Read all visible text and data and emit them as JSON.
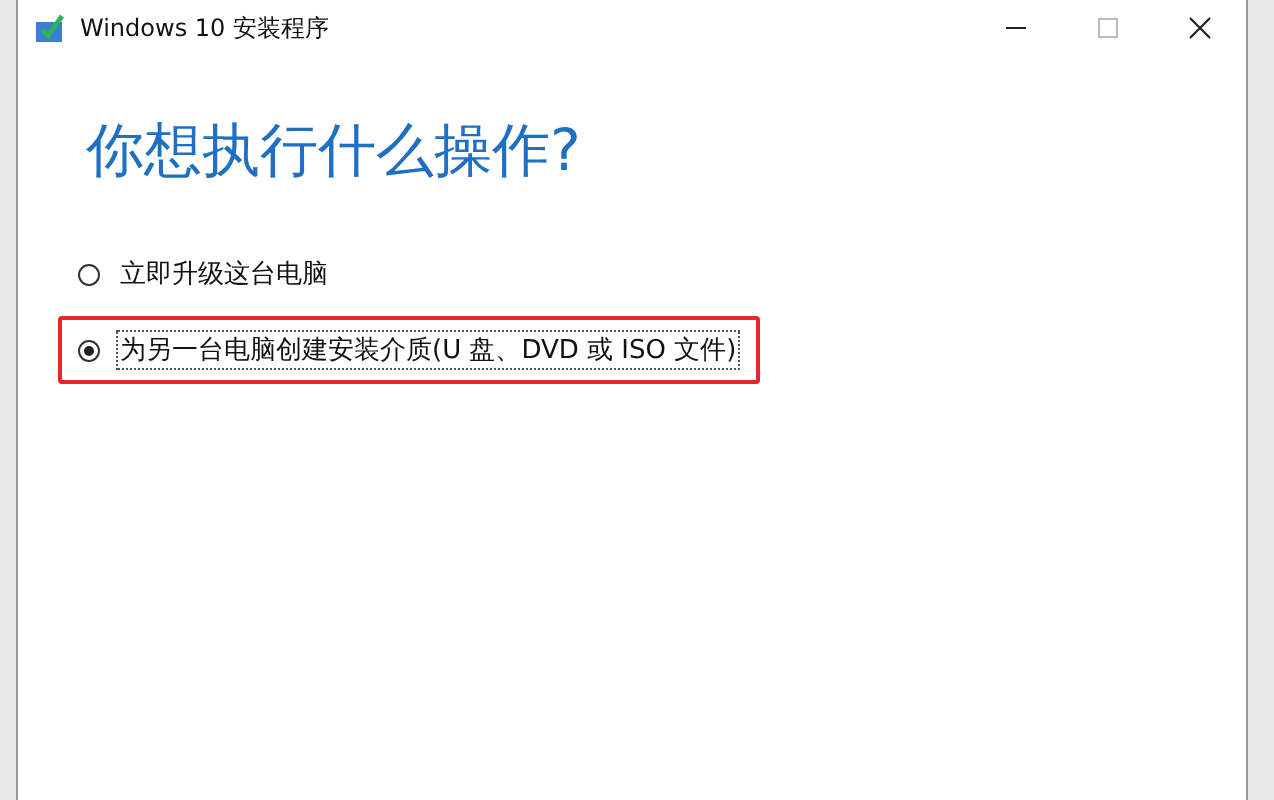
{
  "window": {
    "title": "Windows 10 安装程序"
  },
  "heading": "你想执行什么操作?",
  "options": [
    {
      "label": "立即升级这台电脑",
      "selected": false,
      "highlighted": false
    },
    {
      "label": "为另一台电脑创建安装介质(U 盘、DVD 或 ISO 文件)",
      "selected": true,
      "highlighted": true
    }
  ]
}
